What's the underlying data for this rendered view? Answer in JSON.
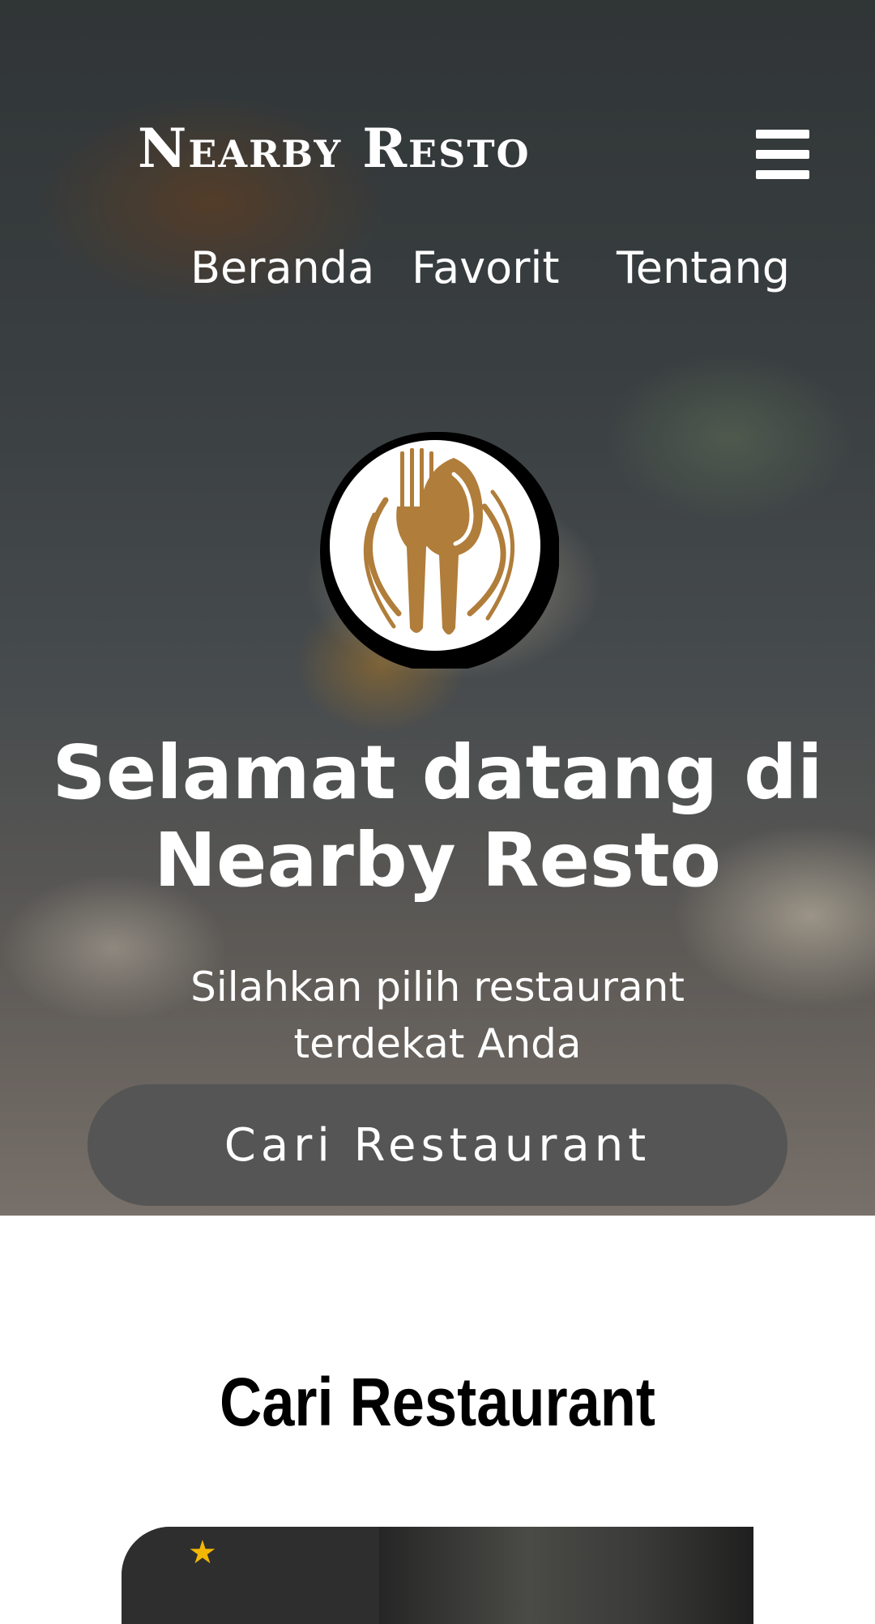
{
  "header": {
    "title": "Nearby Resto"
  },
  "nav": {
    "items": [
      {
        "label": "Beranda"
      },
      {
        "label": "Favorit"
      },
      {
        "label": "Tentang"
      }
    ]
  },
  "hero": {
    "title": "Selamat datang di Nearby Resto",
    "subtitle": "Silahkan pilih restaurant terdekat Anda",
    "button_label": "Cari Restaurant"
  },
  "main": {
    "section_title": "Cari Restaurant",
    "card": {
      "rating": ""
    }
  },
  "colors": {
    "accent_gold": "#b07d3a",
    "button_gray": "#555555"
  },
  "icons": {
    "menu": "hamburger-icon",
    "logo": "fork-spoon-logo-icon",
    "rating": "star-icon"
  }
}
